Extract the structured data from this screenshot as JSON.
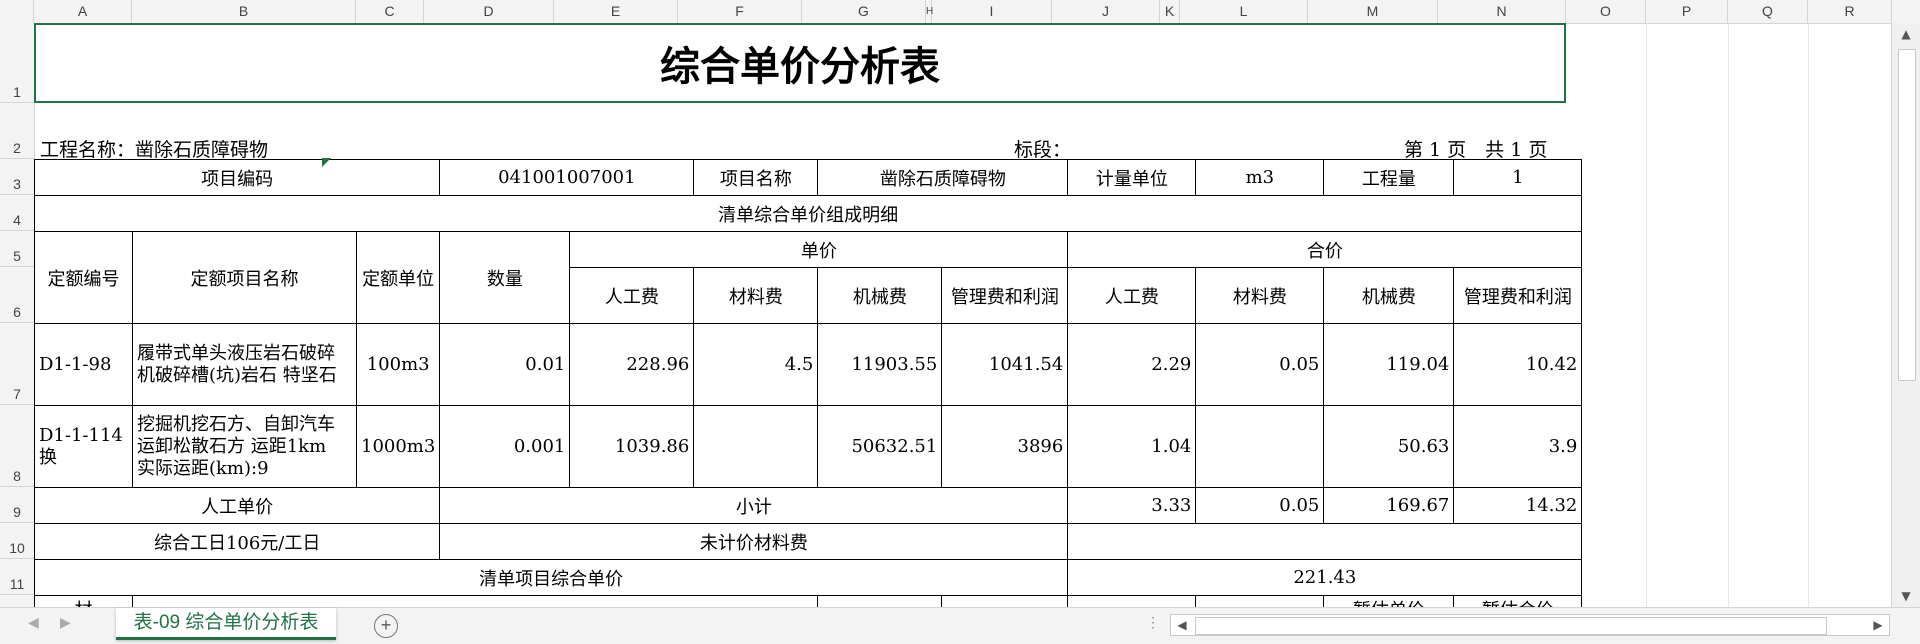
{
  "columns": [
    "A",
    "B",
    "C",
    "D",
    "E",
    "F",
    "G",
    "H",
    "I",
    "J",
    "K",
    "L",
    "M",
    "N",
    "O",
    "P",
    "Q",
    "R"
  ],
  "rows": [
    "1",
    "2",
    "3",
    "4",
    "5",
    "6",
    "7",
    "8",
    "9",
    "10",
    "11"
  ],
  "title": "综合单价分析表",
  "project_label": "工程名称：凿除石质障碍物",
  "section_label": "标段：",
  "page_label": "第 1 页　共 1 页",
  "header": {
    "code_label": "项目编码",
    "code_value": "041001007001",
    "name_label": "项目名称",
    "name_value": "凿除石质障碍物",
    "unit_label": "计量单位",
    "unit_value": "m3",
    "qty_label": "工程量",
    "qty_value": "1"
  },
  "detail_title": "清单综合单价组成明细",
  "cols": {
    "quota_code": "定额编号",
    "quota_name": "定额项目名称",
    "quota_unit": "定额单位",
    "quantity": "数量",
    "unit_price": "单价",
    "total_price": "合价",
    "labor": "人工费",
    "material": "材料费",
    "machine": "机械费",
    "mgmt": "管理费和利润"
  },
  "items": [
    {
      "code": "D1-1-98",
      "name": "履带式单头液压岩石破碎机破碎槽(坑)岩石 特坚石",
      "unit": "100m3",
      "qty": "0.01",
      "u_labor": "228.96",
      "u_material": "4.5",
      "u_machine": "11903.55",
      "u_mgmt": "1041.54",
      "t_labor": "2.29",
      "t_material": "0.05",
      "t_machine": "119.04",
      "t_mgmt": "10.42"
    },
    {
      "code": "D1-1-114换",
      "name": "挖掘机挖石方、自卸汽车运卸松散石方 运距1km　实际运距(km):9",
      "unit": "1000m3",
      "qty": "0.001",
      "u_labor": "1039.86",
      "u_material": "",
      "u_machine": "50632.51",
      "u_mgmt": "3896",
      "t_labor": "1.04",
      "t_material": "",
      "t_machine": "50.63",
      "t_mgmt": "3.9"
    }
  ],
  "labor_unit_label": "人工单价",
  "subtotal_label": "小计",
  "subtotal": {
    "labor": "3.33",
    "material": "0.05",
    "machine": "169.67",
    "mgmt": "14.32"
  },
  "daily_rate": "综合工日106元/工日",
  "unpriced_label": "未计价材料费",
  "unit_total_label": "清单项目综合单价",
  "unit_total_value": "221.43",
  "row12": {
    "a": "材",
    "m": "暂估单价",
    "n": "暂估合价"
  },
  "sheet_tab": "表-09 综合单价分析表",
  "colors": {
    "accent": "#217346"
  }
}
